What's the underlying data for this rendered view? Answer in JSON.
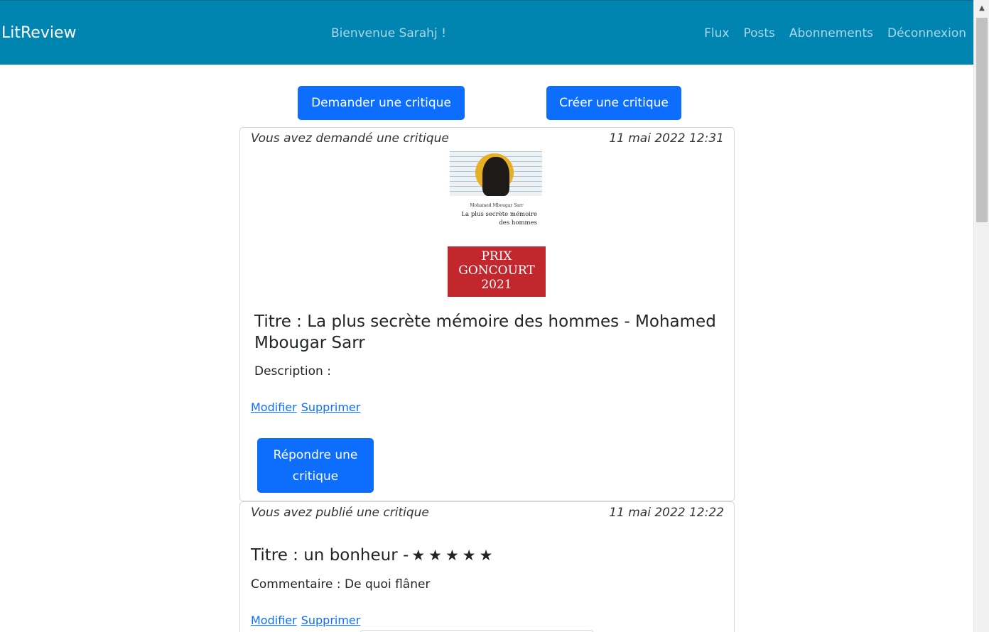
{
  "navbar": {
    "brand": "LitReview",
    "welcome": "Bienvenue Sarahj !",
    "links": [
      "Flux",
      "Posts",
      "Abonnements",
      "Déconnexion"
    ],
    "background": "#0085b0"
  },
  "actions": {
    "ask_review": "Demander une critique",
    "create_review": "Créer une critique",
    "button_color": "#0d6efd"
  },
  "ticket": {
    "meta": "Vous avez demandé une critique",
    "date": "11 mai 2022 12:31",
    "cover": {
      "author": "Mohamed Mbougar Sarr",
      "title_line1": "La plus secrète mémoire",
      "title_line2": "des hommes",
      "band_line1": "PRIX",
      "band_line2": "GONCOURT",
      "band_line3": "2021"
    },
    "title": "Titre : La plus secrète mémoire des hommes - Mohamed Mbougar Sarr",
    "description": "Description :",
    "edit": "Modifier",
    "delete": "Supprimer",
    "answer": "Répondre une critique"
  },
  "review": {
    "meta": "Vous avez publié une critique",
    "date": "11 mai 2022 12:22",
    "title": "Titre : un bonheur -",
    "stars": "★★★★★",
    "rating": 5,
    "comment": "Commentaire : De quoi flâner",
    "edit": "Modifier",
    "delete": "Supprimer"
  }
}
